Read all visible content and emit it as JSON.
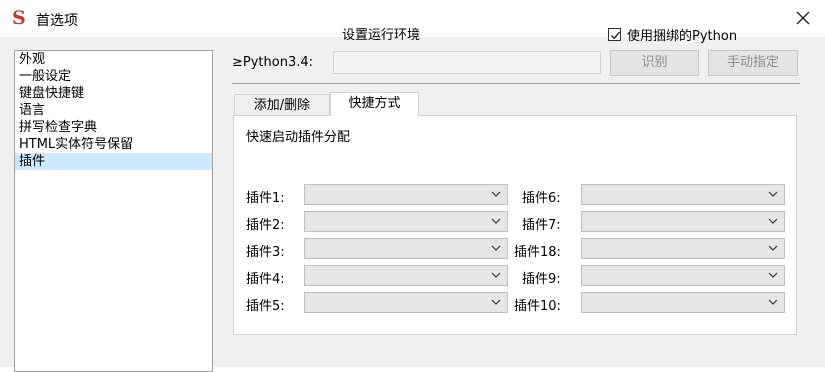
{
  "window": {
    "title": "首选项",
    "app_icon_glyph": "S",
    "app_icon_color": "#c0392b"
  },
  "sidebar": {
    "items": [
      {
        "label": "外观",
        "selected": false
      },
      {
        "label": "一般设定",
        "selected": false
      },
      {
        "label": "键盘快捷键",
        "selected": false
      },
      {
        "label": "语言",
        "selected": false
      },
      {
        "label": "拼写检查字典",
        "selected": false
      },
      {
        "label": "HTML实体符号保留",
        "selected": false
      },
      {
        "label": "插件",
        "selected": true
      }
    ]
  },
  "environment": {
    "title": "设置运行环境",
    "use_bundled_label": "使用捆绑的Python",
    "use_bundled_checked": true,
    "python_label": "≥Python3.4:",
    "path_value": "",
    "identify_button": "识别",
    "manual_button": "手动指定"
  },
  "tabs": [
    {
      "label": "添加/删除",
      "active": false
    },
    {
      "label": "快捷方式",
      "active": true
    }
  ],
  "shortcut_panel": {
    "title": "快速启动插件分配",
    "left_column": [
      {
        "label": "插件1:",
        "value": ""
      },
      {
        "label": "插件2:",
        "value": ""
      },
      {
        "label": "插件3:",
        "value": ""
      },
      {
        "label": "插件4:",
        "value": ""
      },
      {
        "label": "插件5:",
        "value": ""
      }
    ],
    "right_column": [
      {
        "label": "插件6:",
        "value": ""
      },
      {
        "label": "插件7:",
        "value": ""
      },
      {
        "label": "插件18:",
        "value": ""
      },
      {
        "label": "插件9:",
        "value": ""
      },
      {
        "label": "插件10:",
        "value": ""
      }
    ]
  }
}
